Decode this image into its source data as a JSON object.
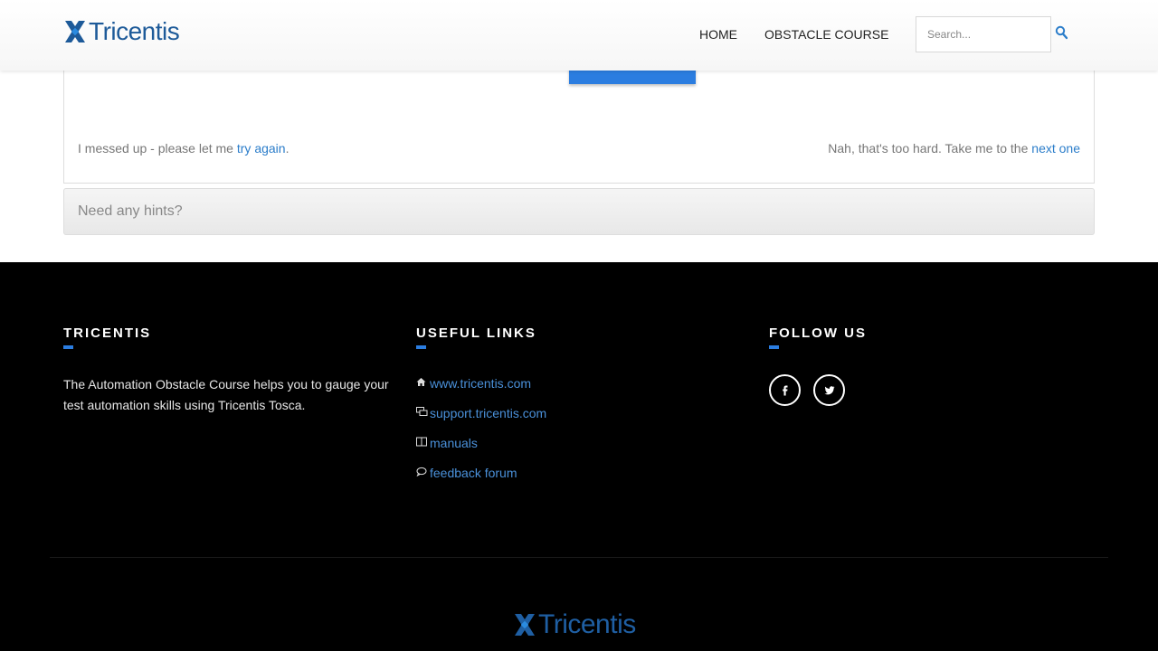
{
  "header": {
    "logo_text": "Tricentis",
    "nav": {
      "home": "HOME",
      "obstacle_course": "OBSTACLE COURSE"
    },
    "search": {
      "placeholder": "Search...",
      "value": ""
    }
  },
  "panel": {
    "retry_prefix": "I messed up - please let me ",
    "retry_link": "try again",
    "retry_suffix": ".",
    "next_prefix": "Nah, that's too hard. Take me to the ",
    "next_link": "next one"
  },
  "hints": {
    "label": "Need any hints?"
  },
  "footer": {
    "col1": {
      "heading": "TRICENTIS",
      "description": "The Automation Obstacle Course helps you to gauge your test automation skills using Tricentis Tosca."
    },
    "col2": {
      "heading": "USEFUL LINKS",
      "links": [
        {
          "icon": "home-icon",
          "label": "www.tricentis.com"
        },
        {
          "icon": "chat-icon",
          "label": "support.tricentis.com"
        },
        {
          "icon": "book-icon",
          "label": "manuals"
        },
        {
          "icon": "comment-icon",
          "label": "feedback forum"
        }
      ]
    },
    "col3": {
      "heading": "FOLLOW US",
      "social": [
        "facebook-icon",
        "twitter-icon"
      ]
    },
    "logo_text": "Tricentis"
  },
  "colors": {
    "accent": "#2b7de0",
    "link": "#2b7dca",
    "brand": "#1d5a99",
    "footer_bg": "#000000"
  }
}
